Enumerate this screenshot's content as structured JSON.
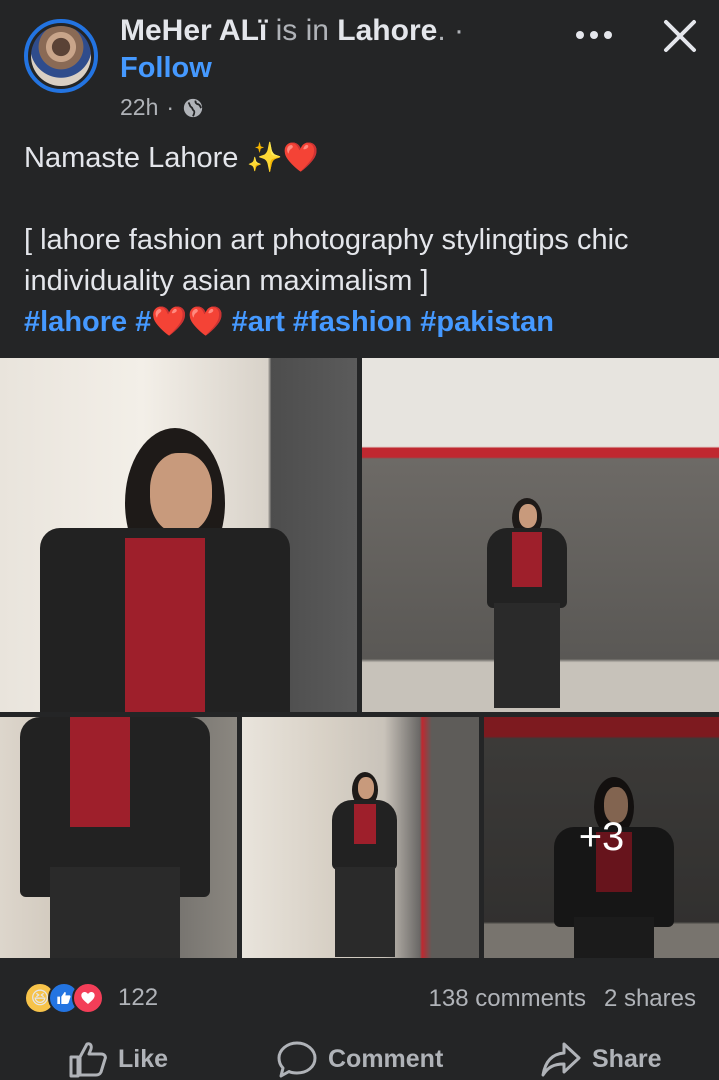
{
  "post": {
    "author": "MeHer ALï",
    "checkin_text": "is in",
    "location": "Lahore",
    "location_suffix": ". ·",
    "follow_label": "Follow",
    "time": "22h",
    "privacy_icon": "globe-icon",
    "caption_line1": "Namaste Lahore ✨❤️",
    "caption_line2": "[ lahore fashion art photography stylingtips chic individuality asian maximalism ]",
    "hashtags": {
      "lahore": "#lahore",
      "hash_prefix": "#",
      "hearts": "❤️❤️",
      "art": "#art",
      "fashion": "#fashion",
      "pakistan": "#pakistan"
    },
    "more_photos": "+3"
  },
  "engagement": {
    "reaction_count": "122",
    "comments": "138 comments",
    "shares": "2 shares"
  },
  "actions": {
    "like": "Like",
    "comment": "Comment",
    "share": "Share"
  },
  "colors": {
    "background": "#242526",
    "link": "#4599ff",
    "muted": "#b0b3b8",
    "text": "#e4e6eb"
  }
}
